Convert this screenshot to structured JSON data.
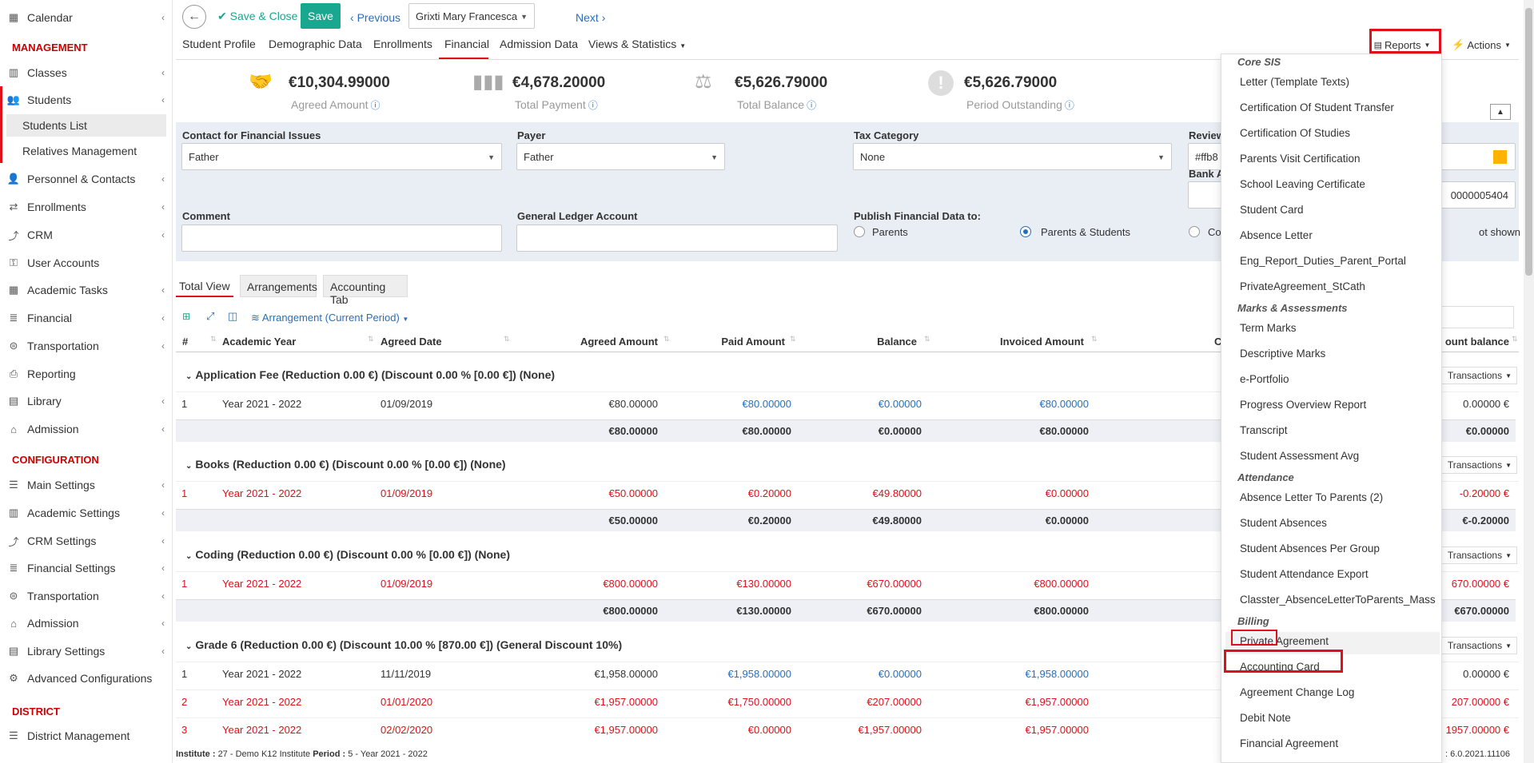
{
  "sidebar": {
    "top_items": [
      {
        "label": "Calendar",
        "icon": "calendar-icon"
      }
    ],
    "management_label": "MANAGEMENT",
    "management_items": [
      {
        "label": "Classes",
        "icon": "classes-icon"
      },
      {
        "label": "Students",
        "icon": "students-icon"
      },
      {
        "label": "Personnel & Contacts",
        "icon": "personnel-icon"
      },
      {
        "label": "Enrollments",
        "icon": "enrollments-icon"
      },
      {
        "label": "CRM",
        "icon": "crm-icon"
      },
      {
        "label": "User Accounts",
        "icon": "key-icon"
      },
      {
        "label": "Academic Tasks",
        "icon": "tasks-icon"
      },
      {
        "label": "Financial",
        "icon": "financial-icon"
      },
      {
        "label": "Transportation",
        "icon": "bus-icon"
      },
      {
        "label": "Reporting",
        "icon": "print-icon"
      },
      {
        "label": "Library",
        "icon": "library-icon"
      },
      {
        "label": "Admission",
        "icon": "bank-icon"
      }
    ],
    "students_sub": [
      "Students List",
      "Relatives Management"
    ],
    "configuration_label": "CONFIGURATION",
    "configuration_items": [
      {
        "label": "Main Settings",
        "icon": "sliders-icon"
      },
      {
        "label": "Academic Settings",
        "icon": "classes-icon"
      },
      {
        "label": "CRM Settings",
        "icon": "crm-icon"
      },
      {
        "label": "Financial Settings",
        "icon": "financial-icon"
      },
      {
        "label": "Transportation",
        "icon": "bus-icon"
      },
      {
        "label": "Admission",
        "icon": "bank-icon"
      },
      {
        "label": "Library Settings",
        "icon": "library-icon"
      },
      {
        "label": "Advanced Configurations",
        "icon": "gears-icon"
      }
    ],
    "district_label": "DISTRICT",
    "district_items": [
      {
        "label": "District Management",
        "icon": "menu-icon"
      }
    ]
  },
  "toolbar": {
    "back": "←",
    "save_close": "Save & Close",
    "save": "Save",
    "previous": "Previous",
    "student": "Grixti Mary Francesca",
    "next": "Next"
  },
  "tabs": [
    "Student Profile",
    "Demographic Data",
    "Enrollments",
    "Financial",
    "Admission Data",
    "Views & Statistics"
  ],
  "header_buttons": {
    "reports": "Reports",
    "actions": "Actions"
  },
  "kpis": [
    {
      "value": "€10,304.99000",
      "label": "Agreed Amount"
    },
    {
      "value": "€4,678.20000",
      "label": "Total Payment"
    },
    {
      "value": "€5,626.79000",
      "label": "Total Balance"
    },
    {
      "value": "€5,626.79000",
      "label": "Period Outstanding"
    }
  ],
  "form": {
    "contact_label": "Contact for Financial Issues",
    "contact_value": "Father",
    "payer_label": "Payer",
    "payer_value": "Father",
    "tax_label": "Tax Category",
    "tax_value": "None",
    "review_label": "Review",
    "review_value": "#ffb8",
    "bank_label": "Bank A",
    "bank_value": "0000005404",
    "comment_label": "Comment",
    "ledger_label": "General Ledger Account",
    "publish_label": "Publish Financial Data to:",
    "publish_options": [
      "Parents",
      "Parents & Students",
      "Co",
      "ot shown"
    ]
  },
  "subtabs": [
    "Total View",
    "Arrangements",
    "Accounting Tab"
  ],
  "table_tools": {
    "arrangement": "Arrangement (Current Period)"
  },
  "table_headers": [
    "#",
    "Academic Year",
    "Agreed Date",
    "Agreed Amount",
    "Paid Amount",
    "Balance",
    "Invoiced Amount",
    "C",
    "ount balance"
  ],
  "transactions_label": "Transactions",
  "groups": [
    {
      "title": "Application Fee (Reduction 0.00 €) (Discount 0.00 % [0.00 €]) (None)",
      "rows": [
        {
          "n": "1",
          "year": "Year 2021 - 2022",
          "date": "01/09/2019",
          "agreed": "€80.00000",
          "paid": "€80.00000",
          "balance": "€0.00000",
          "invoiced": "€80.00000",
          "acct": "0.00000 €",
          "red": false
        }
      ],
      "totals": {
        "agreed": "€80.00000",
        "paid": "€80.00000",
        "balance": "€0.00000",
        "invoiced": "€80.00000",
        "acct": "€0.00000"
      }
    },
    {
      "title": "Books (Reduction 0.00 €) (Discount 0.00 % [0.00 €]) (None)",
      "rows": [
        {
          "n": "1",
          "year": "Year 2021 - 2022",
          "date": "01/09/2019",
          "agreed": "€50.00000",
          "paid": "€0.20000",
          "balance": "€49.80000",
          "invoiced": "€0.00000",
          "acct": "-0.20000 €",
          "red": true
        }
      ],
      "totals": {
        "agreed": "€50.00000",
        "paid": "€0.20000",
        "balance": "€49.80000",
        "invoiced": "€0.00000",
        "acct": "€-0.20000"
      }
    },
    {
      "title": "Coding (Reduction 0.00 €) (Discount 0.00 % [0.00 €]) (None)",
      "rows": [
        {
          "n": "1",
          "year": "Year 2021 - 2022",
          "date": "01/09/2019",
          "agreed": "€800.00000",
          "paid": "€130.00000",
          "balance": "€670.00000",
          "invoiced": "€800.00000",
          "acct": "670.00000 €",
          "red": true
        }
      ],
      "totals": {
        "agreed": "€800.00000",
        "paid": "€130.00000",
        "balance": "€670.00000",
        "invoiced": "€800.00000",
        "acct": "€670.00000"
      }
    },
    {
      "title": "Grade 6 (Reduction 0.00 €) (Discount 10.00 % [870.00 €]) (General Discount 10%)",
      "rows": [
        {
          "n": "1",
          "year": "Year 2021 - 2022",
          "date": "11/11/2019",
          "agreed": "€1,958.00000",
          "paid": "€1,958.00000",
          "balance": "€0.00000",
          "invoiced": "€1,958.00000",
          "acct": "0.00000 €",
          "red": false
        },
        {
          "n": "2",
          "year": "Year 2021 - 2022",
          "date": "01/01/2020",
          "agreed": "€1,957.00000",
          "paid": "€1,750.00000",
          "balance": "€207.00000",
          "invoiced": "€1,957.00000",
          "acct": "207.00000 €",
          "red": true
        },
        {
          "n": "3",
          "year": "Year 2021 - 2022",
          "date": "02/02/2020",
          "agreed": "€1,957.00000",
          "paid": "€0.00000",
          "balance": "€1,957.00000",
          "invoiced": "€1,957.00000",
          "acct": "1957.00000 €",
          "red": true
        }
      ]
    }
  ],
  "reports_menu": [
    {
      "header": "Core SIS",
      "items": [
        "Letter (Template Texts)",
        "Certification Of Student Transfer",
        "Certification Of Studies",
        "Parents Visit Certification",
        "School Leaving Certificate",
        "Student Card",
        "Absence Letter",
        "Eng_Report_Duties_Parent_Portal",
        "PrivateAgreement_StCath"
      ]
    },
    {
      "header": "Marks & Assessments",
      "items": [
        "Term Marks",
        "Descriptive Marks",
        "e-Portfolio",
        "Progress Overview Report",
        "Transcript",
        "Student Assessment Avg"
      ]
    },
    {
      "header": "Attendance",
      "items": [
        "Absence Letter To Parents (2)",
        "Student Absences",
        "Student Absences Per Group",
        "Student Attendance Export",
        "Classter_AbsenceLetterToParents_Mass"
      ]
    },
    {
      "header": "Billing",
      "items": [
        "Private Agreement",
        "Accounting Card",
        "Agreement Change Log",
        "Debit Note",
        "Financial Agreement"
      ]
    }
  ],
  "footer": {
    "institute_label": "Institute :",
    "institute": "27 - Demo K12 Institute",
    "period_label": "Period :",
    "period": "5 - Year 2021 - 2022",
    "version": ": 6.0.2021.11106"
  },
  "colors": {
    "accent_green": "#1aa78f",
    "link_blue": "#2a6ebb",
    "red": "#e0101a",
    "section_red": "#cc0000"
  }
}
